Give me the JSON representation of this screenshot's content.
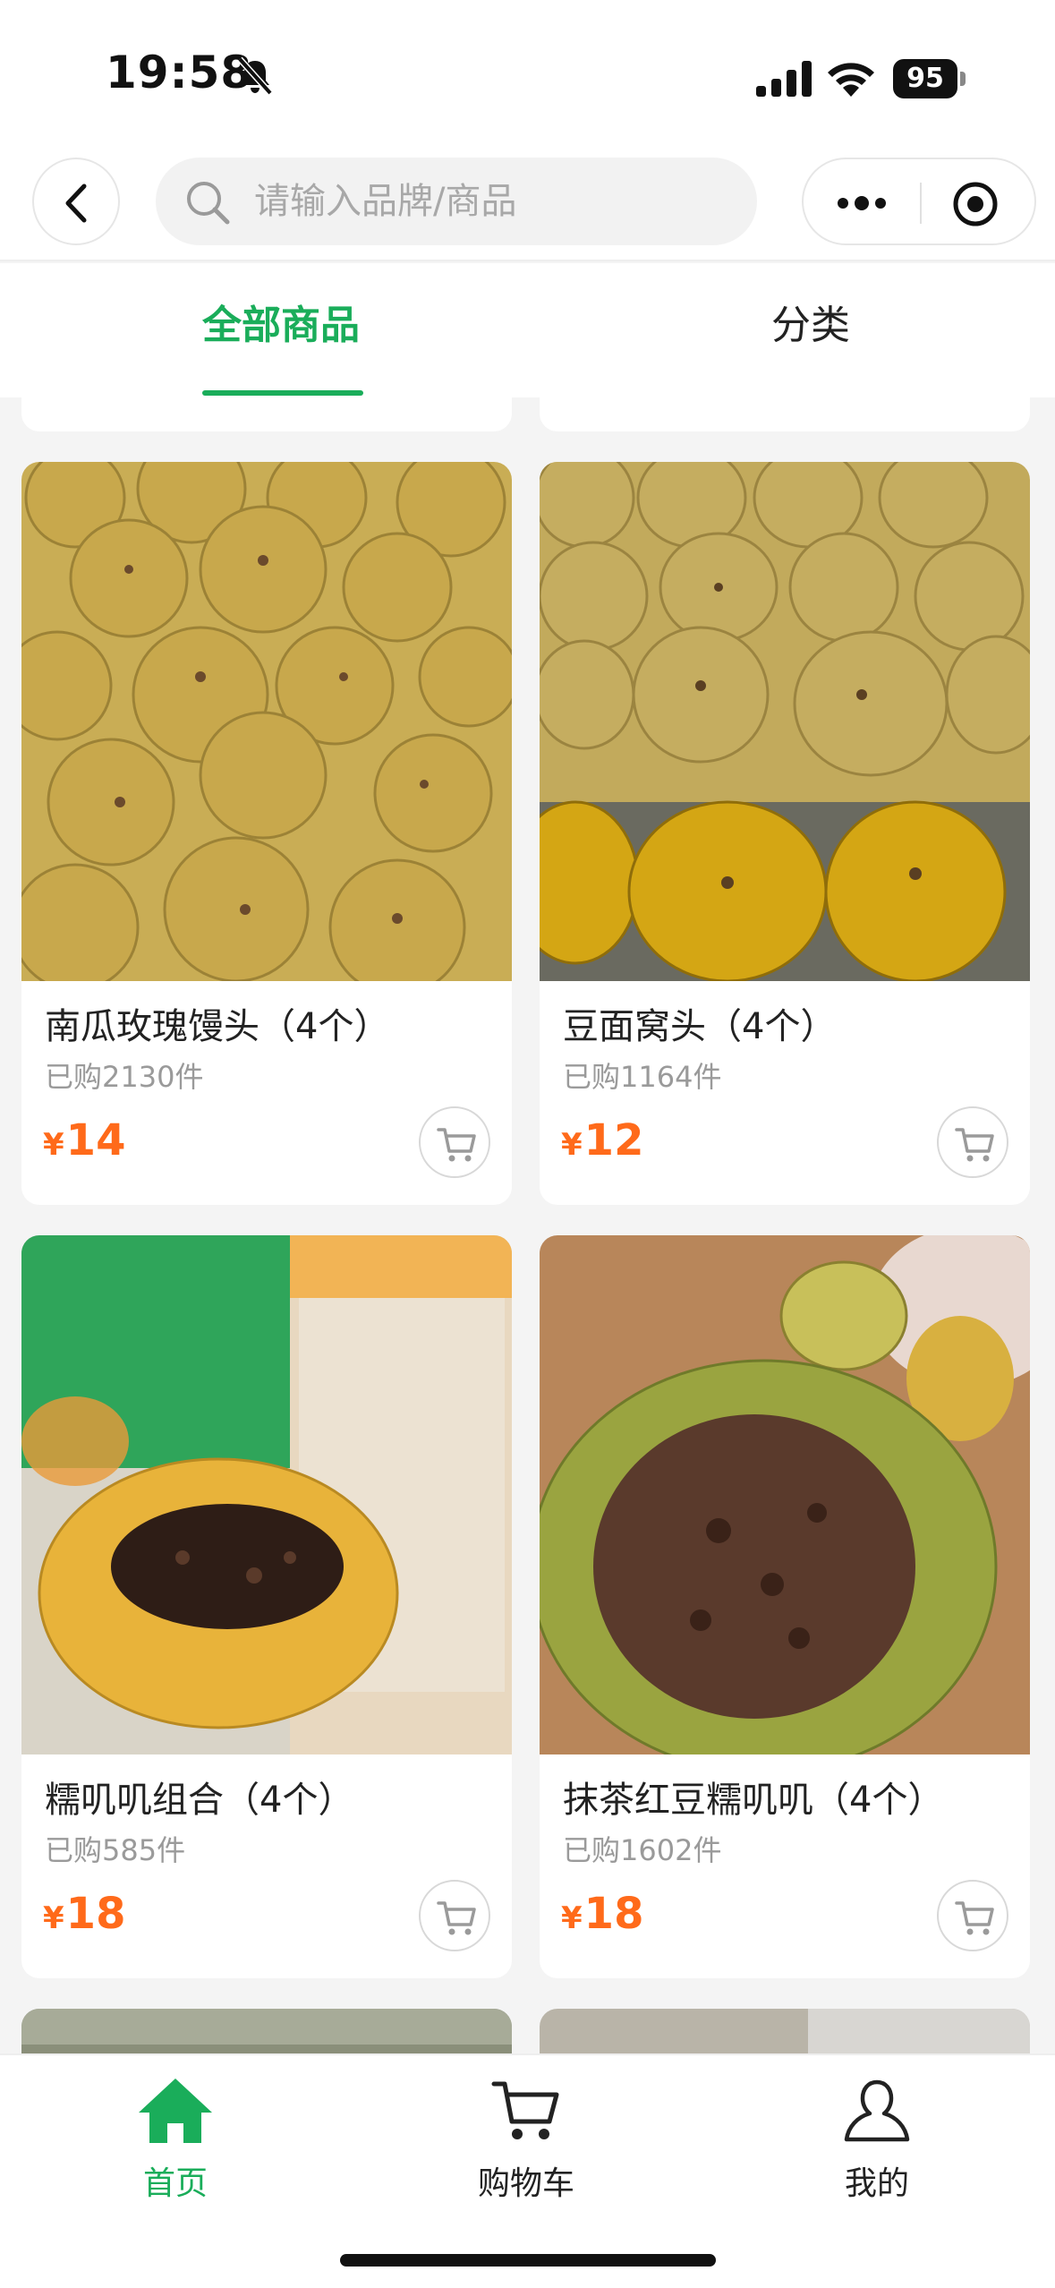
{
  "status_bar": {
    "time": "19:58",
    "battery": "95"
  },
  "search": {
    "placeholder": "请输入品牌/商品"
  },
  "tabs": [
    {
      "label": "全部商品",
      "active": true
    },
    {
      "label": "分类",
      "active": false
    }
  ],
  "products": [
    {
      "title": "南瓜玫瑰馒头（4个）",
      "sold": "已购2130件",
      "currency": "¥",
      "price": "14"
    },
    {
      "title": "豆面窝头（4个）",
      "sold": "已购1164件",
      "currency": "¥",
      "price": "12"
    },
    {
      "title": "糯叽叽组合（4个）",
      "sold": "已购585件",
      "currency": "¥",
      "price": "18"
    },
    {
      "title": "抹茶红豆糯叽叽（4个）",
      "sold": "已购1602件",
      "currency": "¥",
      "price": "18"
    }
  ],
  "tabbar": [
    {
      "label": "首页",
      "icon": "home-icon",
      "active": true
    },
    {
      "label": "购物车",
      "icon": "cart-icon",
      "active": false
    },
    {
      "label": "我的",
      "icon": "user-icon",
      "active": false
    }
  ],
  "colors": {
    "accent": "#1aad5a",
    "price": "#ff6a1a"
  }
}
